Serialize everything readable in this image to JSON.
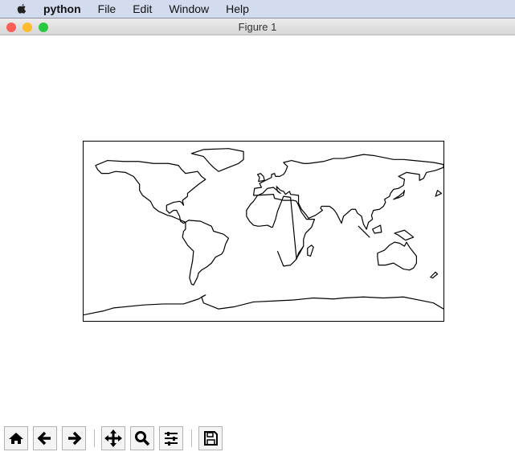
{
  "menubar": {
    "app": "python",
    "items": [
      "File",
      "Edit",
      "Window",
      "Help"
    ]
  },
  "window": {
    "title": "Figure 1"
  },
  "toolbar": {
    "buttons": [
      "home",
      "back",
      "forward",
      "pan",
      "zoom",
      "configure-subplots",
      "save"
    ]
  }
}
